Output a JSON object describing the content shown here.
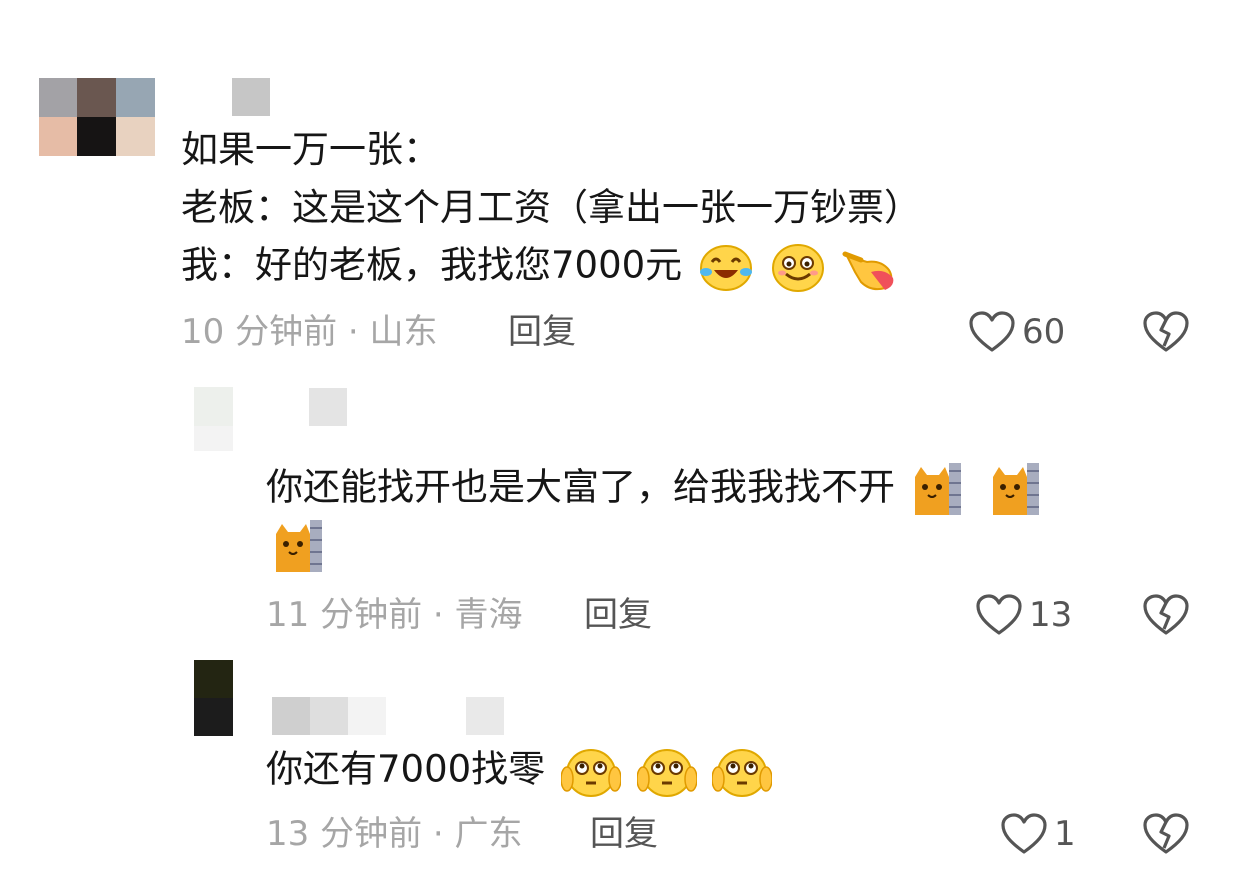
{
  "comments": [
    {
      "lines": [
        "如果一万一张：",
        "老板：这是这个月工资（拿出一张一万钞票）",
        "我：好的老板，我找您7000元"
      ],
      "emojis": [
        "laugh-cry-emoji",
        "grin-emoji",
        "pointing-hand-emoji"
      ],
      "time": "10 分钟前 · 山东",
      "reply": "回复",
      "likes": "60"
    },
    {
      "lines": [
        "你还能找开也是大富了，给我我找不开"
      ],
      "emojis": [
        "cat-peeking-emoji",
        "cat-peeking-emoji",
        "cat-peeking-emoji"
      ],
      "time": "11 分钟前 · 青海",
      "reply": "回复",
      "likes": "13"
    },
    {
      "lines": [
        "你还有7000找零"
      ],
      "emojis": [
        "shocked-face-emoji",
        "shocked-face-emoji",
        "shocked-face-emoji"
      ],
      "time": "13 分钟前 · 广东",
      "reply": "回复",
      "likes": "1"
    }
  ],
  "colors": {
    "text": "#161616",
    "meta": "#a6a6a6",
    "icon": "#555555"
  }
}
